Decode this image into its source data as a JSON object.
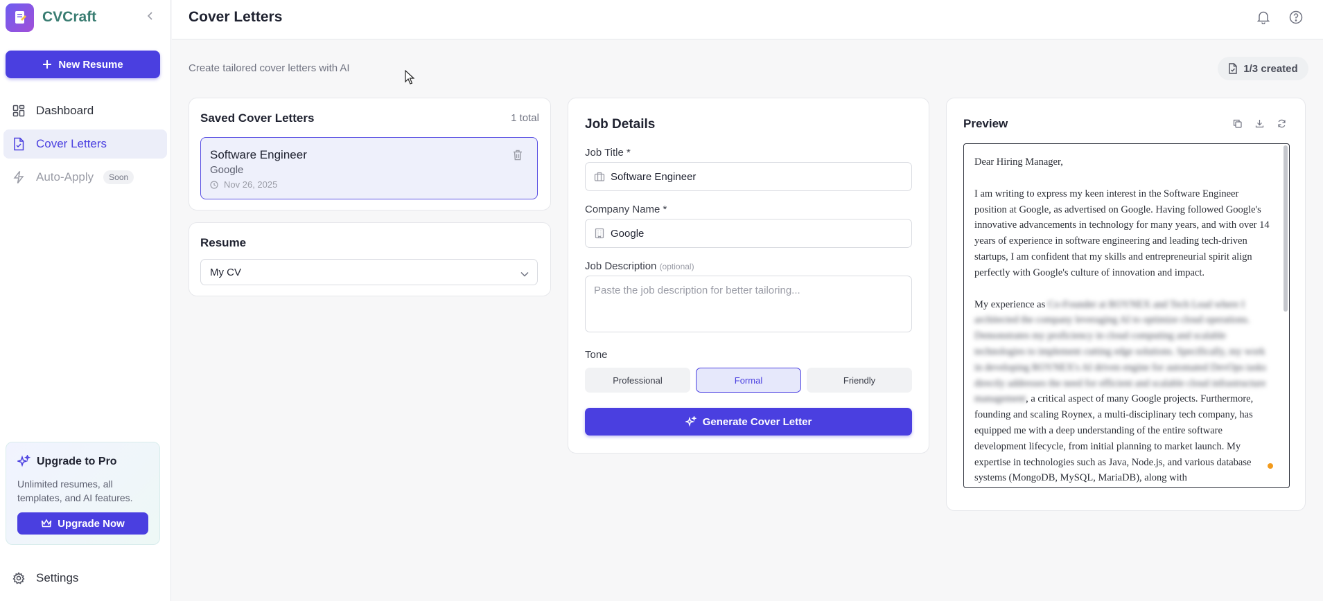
{
  "app": {
    "brand": "CVCraft"
  },
  "sidebar": {
    "new_resume_label": "New Resume",
    "items": [
      {
        "label": "Dashboard",
        "icon": "dashboard-icon"
      },
      {
        "label": "Cover Letters",
        "icon": "file-text-icon",
        "active": true
      },
      {
        "label": "Auto-Apply",
        "icon": "lightning-icon",
        "badge": "Soon",
        "disabled": true
      }
    ],
    "upgrade": {
      "title": "Upgrade to Pro",
      "text": "Unlimited resumes, all templates, and AI features.",
      "button_label": "Upgrade Now"
    },
    "settings_label": "Settings"
  },
  "header": {
    "title": "Cover Letters"
  },
  "page": {
    "subtitle": "Create tailored cover letters with AI",
    "usage_counter": "1/3 created"
  },
  "saved": {
    "title": "Saved Cover Letters",
    "count": "1 total",
    "items": [
      {
        "title": "Software Engineer",
        "company": "Google",
        "date": "Nov 26, 2025"
      }
    ]
  },
  "resume": {
    "title": "Resume",
    "selected": "My CV"
  },
  "job_details": {
    "title": "Job Details",
    "job_title_label": "Job Title *",
    "job_title_value": "Software Engineer",
    "company_label": "Company Name *",
    "company_value": "Google",
    "description_label": "Job Description",
    "description_optional": "(optional)",
    "description_placeholder": "Paste the job description for better tailoring...",
    "tone_label": "Tone",
    "tones": [
      "Professional",
      "Formal",
      "Friendly"
    ],
    "selected_tone": "Formal",
    "generate_label": "Generate Cover Letter"
  },
  "preview": {
    "title": "Preview",
    "greeting": "Dear Hiring Manager,",
    "paragraph1": "I am writing to express my keen interest in the Software Engineer position at Google, as advertised on Google. Having followed Google's innovative advancements in technology for many years, and with over 14 years of experience in software engineering and leading tech-driven startups, I am confident that my skills and entrepreneurial spirit align perfectly with Google's culture of innovation and impact.",
    "paragraph2_start": "My experience as",
    "paragraph2_end": ", a critical aspect of many Google projects. Furthermore, founding and scaling Roynex, a multi-disciplinary tech company, has equipped me with a deep understanding of the entire software development lifecycle, from initial planning to market launch. My expertise in technologies such as Java, Node.js, and various database systems (MongoDB, MySQL, MariaDB), along with"
  },
  "colors": {
    "accent": "#4a3fe0",
    "brand_text": "#3a7d72",
    "active_nav_bg": "#eceef9",
    "status_dot": "#f29a1c"
  }
}
